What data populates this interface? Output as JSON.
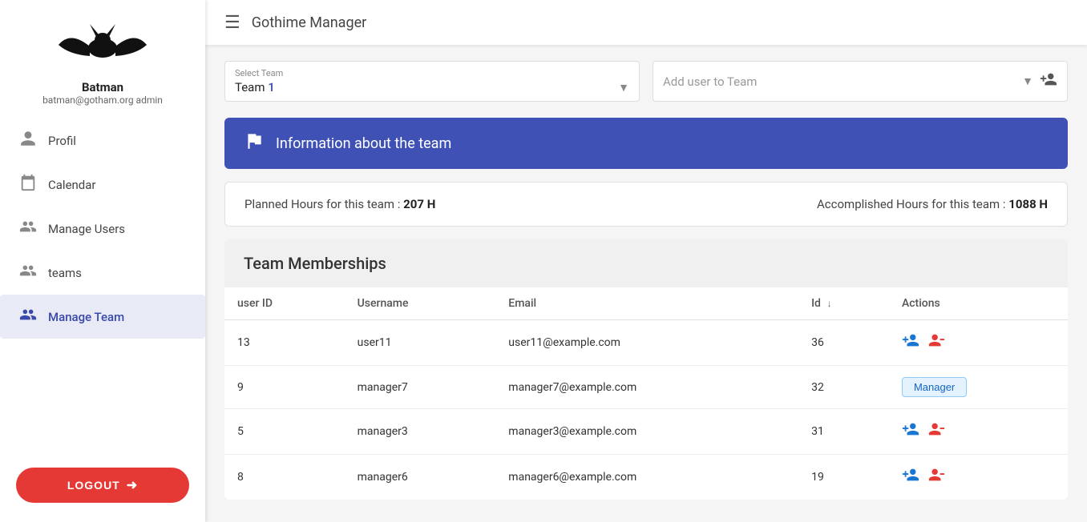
{
  "sidebar": {
    "username": "Batman",
    "email": "batman@gotham.org admin",
    "nav": [
      {
        "id": "profil",
        "label": "Profil",
        "icon": "👤",
        "active": false
      },
      {
        "id": "calendar",
        "label": "Calendar",
        "icon": "📅",
        "active": false
      },
      {
        "id": "manage-users",
        "label": "Manage Users",
        "icon": "👥",
        "active": false
      },
      {
        "id": "teams",
        "label": "teams",
        "icon": "👥",
        "active": false
      },
      {
        "id": "manage-team",
        "label": "Manage Team",
        "icon": "👥",
        "active": true
      }
    ],
    "logout_label": "LOGOUT"
  },
  "topbar": {
    "title": "Gothime Manager"
  },
  "select_team": {
    "label": "Select Team",
    "value_prefix": "Team ",
    "value_highlight": "1"
  },
  "add_user": {
    "placeholder": "Add user to Team"
  },
  "info_banner": {
    "text": "Information about the team"
  },
  "stats": {
    "planned_label": "Planned Hours for this team :",
    "planned_value": "207 H",
    "accomplished_label": "Accomplished Hours for this team :",
    "accomplished_value": "1088 H"
  },
  "memberships": {
    "title": "Team Memberships",
    "columns": [
      "user ID",
      "Username",
      "Email",
      "Id",
      "Actions"
    ],
    "rows": [
      {
        "user_id": "13",
        "username": "user11",
        "email": "user11@example.com",
        "id": "36",
        "type": "actions"
      },
      {
        "user_id": "9",
        "username": "manager7",
        "email": "manager7@example.com",
        "id": "32",
        "type": "manager"
      },
      {
        "user_id": "5",
        "username": "manager3",
        "email": "manager3@example.com",
        "id": "31",
        "type": "actions"
      },
      {
        "user_id": "8",
        "username": "manager6",
        "email": "manager6@example.com",
        "id": "19",
        "type": "actions"
      }
    ],
    "manager_badge_label": "Manager"
  },
  "colors": {
    "accent": "#3f51b5",
    "logout_red": "#e53935",
    "action_blue": "#1976d2",
    "action_red": "#e53935"
  }
}
